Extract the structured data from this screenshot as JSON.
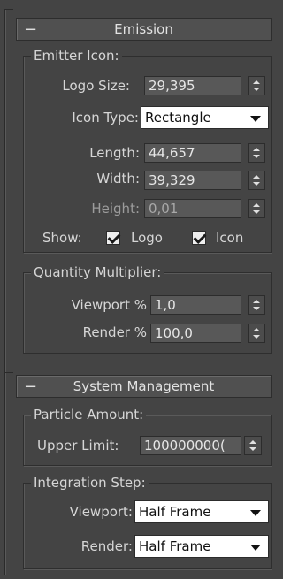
{
  "emission": {
    "title": "Emission",
    "emitter_icon": {
      "legend": "Emitter Icon:",
      "logo_size_label": "Logo Size:",
      "logo_size_value": "29,395",
      "icon_type_label": "Icon Type:",
      "icon_type_value": "Rectangle",
      "length_label": "Length:",
      "length_value": "44,657",
      "width_label": "Width:",
      "width_value": "39,329",
      "height_label": "Height:",
      "height_value": "0,01",
      "show_label": "Show:",
      "show_logo_label": "Logo",
      "show_logo_checked": true,
      "show_icon_label": "Icon",
      "show_icon_checked": true
    },
    "quantity_multiplier": {
      "legend": "Quantity Multiplier:",
      "viewport_label": "Viewport %",
      "viewport_value": "1,0",
      "render_label": "Render %",
      "render_value": "100,0"
    }
  },
  "system_management": {
    "title": "System Management",
    "particle_amount": {
      "legend": "Particle Amount:",
      "upper_limit_label": "Upper Limit:",
      "upper_limit_value": "100000000("
    },
    "integration_step": {
      "legend": "Integration Step:",
      "viewport_label": "Viewport:",
      "viewport_value": "Half Frame",
      "render_label": "Render:",
      "render_value": "Half Frame"
    }
  },
  "rollout_toggle_symbol": "−"
}
